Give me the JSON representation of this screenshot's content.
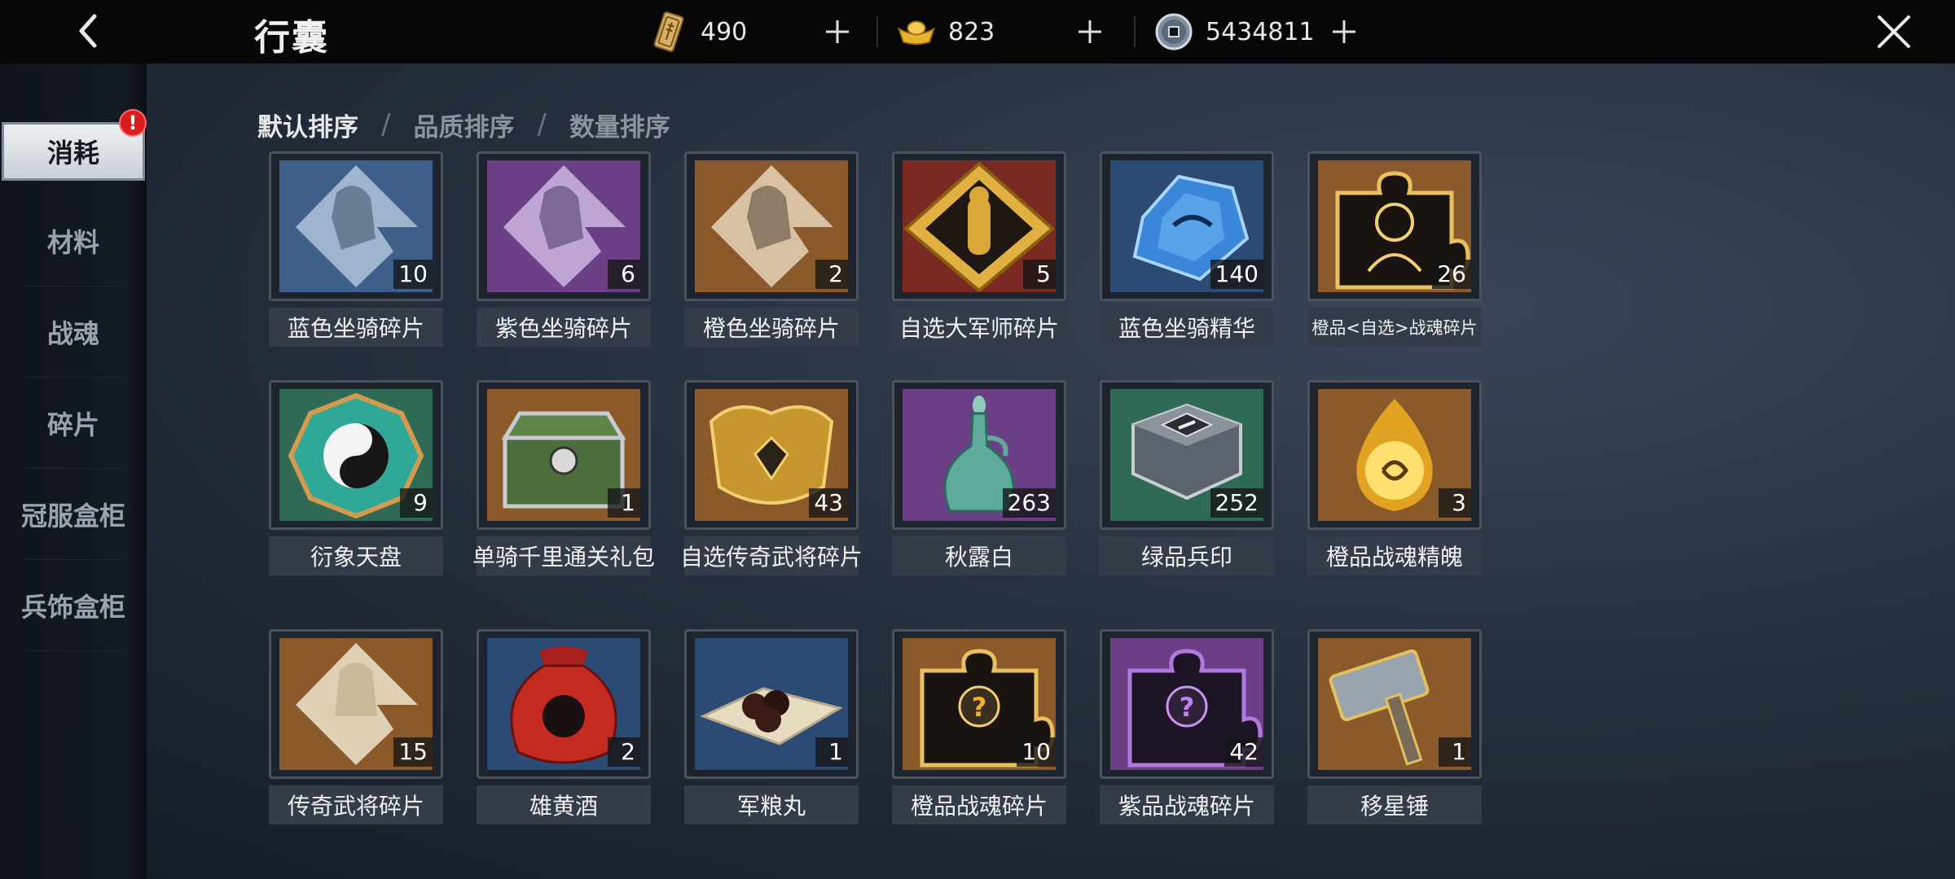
{
  "header": {
    "title": "行囊",
    "currencies": [
      {
        "icon": "ticket-icon",
        "value": "490"
      },
      {
        "icon": "gold-ingot-icon",
        "value": "823"
      },
      {
        "icon": "coin-icon",
        "value": "5434811"
      }
    ]
  },
  "sidebar": {
    "badge": "!",
    "items": [
      {
        "label": "消耗"
      },
      {
        "label": "材料"
      },
      {
        "label": "战魂"
      },
      {
        "label": "碎片"
      },
      {
        "label": "冠服盒柜"
      },
      {
        "label": "兵饰盒柜"
      }
    ]
  },
  "sort": {
    "options": [
      "默认排序",
      "品质排序",
      "数量排序"
    ],
    "separator": "/"
  },
  "items": [
    {
      "name": "蓝色坐骑碎片",
      "count": "10",
      "icon": "blue-mount-shard-icon"
    },
    {
      "name": "紫色坐骑碎片",
      "count": "6",
      "icon": "purple-mount-shard-icon"
    },
    {
      "name": "橙色坐骑碎片",
      "count": "2",
      "icon": "orange-mount-shard-icon"
    },
    {
      "name": "自选大军师碎片",
      "count": "5",
      "icon": "strategist-shard-icon"
    },
    {
      "name": "蓝色坐骑精华",
      "count": "140",
      "icon": "blue-crystal-icon"
    },
    {
      "name": "橙品<自选>战魂碎片",
      "count": "26",
      "icon": "orange-warsoul-select-shard-icon"
    },
    {
      "name": "衍象天盘",
      "count": "9",
      "icon": "bagua-plate-icon"
    },
    {
      "name": "单骑千里通关礼包",
      "count": "1",
      "icon": "gift-chest-icon"
    },
    {
      "name": "自选传奇武将碎片",
      "count": "43",
      "icon": "golden-armor-icon"
    },
    {
      "name": "秋露白",
      "count": "263",
      "icon": "wine-bottle-icon"
    },
    {
      "name": "绿品兵印",
      "count": "252",
      "icon": "hexagon-seal-icon"
    },
    {
      "name": "橙品战魂精魄",
      "count": "3",
      "icon": "fire-orb-icon"
    },
    {
      "name": "传奇武将碎片",
      "count": "15",
      "icon": "legend-general-shard-icon"
    },
    {
      "name": "雄黄酒",
      "count": "2",
      "icon": "wine-jar-icon"
    },
    {
      "name": "军粮丸",
      "count": "1",
      "icon": "ration-pills-icon"
    },
    {
      "name": "橙品战魂碎片",
      "count": "10",
      "icon": "orange-warsoul-shard-icon"
    },
    {
      "name": "紫品战魂碎片",
      "count": "42",
      "icon": "purple-warsoul-shard-icon"
    },
    {
      "name": "移星锤",
      "count": "1",
      "icon": "hammer-icon"
    }
  ],
  "colors": {
    "blue_bg": "#3d5f8a",
    "purple_bg": "#6a3f86",
    "orange_bg": "#8a5a2a",
    "green_bg": "#2f6a54",
    "count_bg": "#141414"
  }
}
